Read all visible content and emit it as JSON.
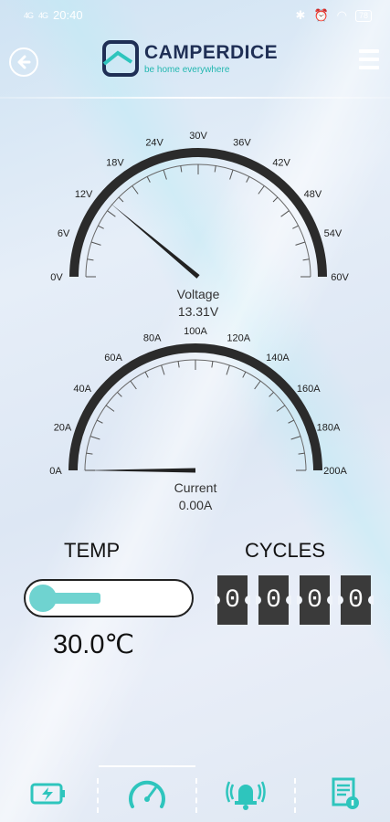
{
  "status_bar": {
    "signal_1": "4G",
    "signal_2": "4G",
    "time": "20:40",
    "battery": "78"
  },
  "header": {
    "brand_name": "CAMPERDICE",
    "tagline": "be home everywhere"
  },
  "voltage_gauge": {
    "label": "Voltage",
    "value_text": "13.31V",
    "value": 13.31,
    "min": 0,
    "max": 60,
    "ticks": [
      "0V",
      "6V",
      "12V",
      "18V",
      "24V",
      "30V",
      "36V",
      "42V",
      "48V",
      "54V",
      "60V"
    ]
  },
  "current_gauge": {
    "label": "Current",
    "value_text": "0.00A",
    "value": 0.0,
    "min": 0,
    "max": 200,
    "ticks": [
      "0A",
      "20A",
      "40A",
      "60A",
      "80A",
      "100A",
      "120A",
      "140A",
      "160A",
      "180A",
      "200A"
    ]
  },
  "temp": {
    "title": "TEMP",
    "value": "30.0℃"
  },
  "cycles": {
    "title": "CYCLES",
    "digits": [
      "0",
      "0",
      "0",
      "0"
    ]
  },
  "nav": {
    "items": [
      "battery-icon",
      "speedometer-icon",
      "alarm-bell-icon",
      "report-icon"
    ],
    "active": 1
  },
  "colors": {
    "accent": "#2ec5bd",
    "gauge_dark": "#2b2b2b",
    "logo_dark": "#1f2f55"
  }
}
